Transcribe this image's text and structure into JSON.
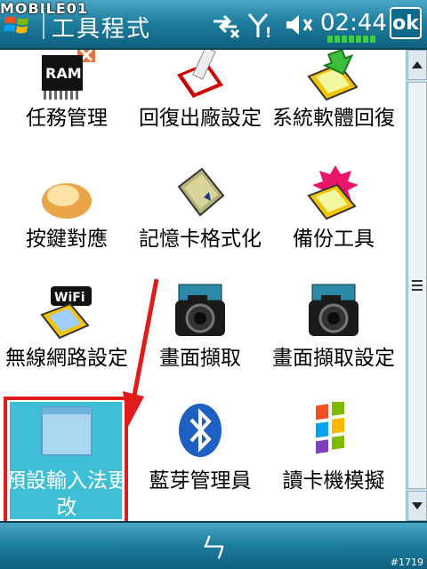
{
  "watermark": "MOBILE01",
  "header": {
    "title": "工具程式",
    "clock": "02:44",
    "ok_label": "ok"
  },
  "items": [
    {
      "label": "任務管理",
      "icon": "ram-chip-icon"
    },
    {
      "label": "回復出廠設定",
      "icon": "pda-reset-icon"
    },
    {
      "label": "系統軟體回復",
      "icon": "pda-restore-icon"
    },
    {
      "label": "按鍵對應",
      "icon": "bread-button-icon"
    },
    {
      "label": "記憶卡格式化",
      "icon": "memory-card-icon"
    },
    {
      "label": "備份工具",
      "icon": "pda-backup-icon"
    },
    {
      "label": "無線網路設定",
      "icon": "wifi-pda-icon"
    },
    {
      "label": "畫面擷取",
      "icon": "camera-icon"
    },
    {
      "label": "畫面擷取設定",
      "icon": "camera-settings-icon"
    },
    {
      "label": "預設輸入法更改",
      "icon": "input-method-icon"
    },
    {
      "label": "藍芽管理員",
      "icon": "bluetooth-icon"
    },
    {
      "label": "讀卡機模擬",
      "icon": "windows-flag-icon"
    }
  ],
  "selected_index": 9,
  "colors": {
    "bar": "#1f7f9f",
    "selection": "#3fbfd6",
    "annotation": "#e21b1b"
  },
  "footer": {
    "back_symbol": "ㄣ",
    "image_id": "#1719"
  }
}
